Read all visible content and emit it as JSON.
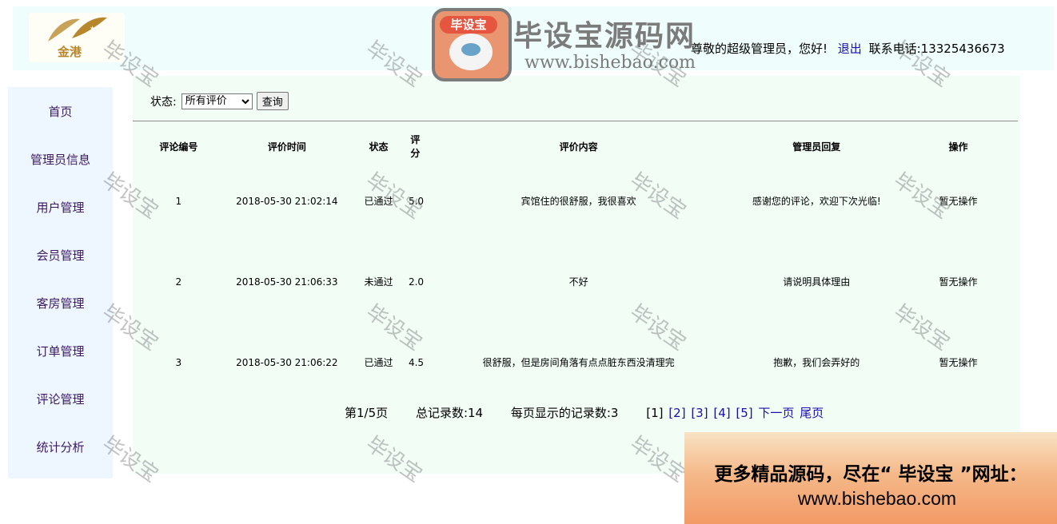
{
  "header": {
    "logo_text": "金港",
    "greeting": "尊敬的超级管理员，您好!",
    "logout_label": "退出",
    "contact": "联系电话:13325436673"
  },
  "sidebar": {
    "items": [
      {
        "label": "首页"
      },
      {
        "label": "管理员信息"
      },
      {
        "label": "用户管理"
      },
      {
        "label": "会员管理"
      },
      {
        "label": "客房管理"
      },
      {
        "label": "订单管理"
      },
      {
        "label": "评论管理"
      },
      {
        "label": "统计分析"
      }
    ]
  },
  "filter": {
    "label": "状态:",
    "selected": "所有评价",
    "query_label": "查询"
  },
  "table": {
    "headers": [
      "评论编号",
      "评价时间",
      "状态",
      "评分",
      "评价内容",
      "管理员回复",
      "操作"
    ],
    "rows": [
      {
        "id": "1",
        "time": "2018-05-30 21:02:14",
        "status": "已通过",
        "score": "5.0",
        "content": "宾馆住的很舒服，我很喜欢",
        "reply": "感谢您的评论，欢迎下次光临!",
        "action": "暂无操作"
      },
      {
        "id": "2",
        "time": "2018-05-30 21:06:33",
        "status": "未通过",
        "score": "2.0",
        "content": "不好",
        "reply": "请说明具体理由",
        "action": "暂无操作"
      },
      {
        "id": "3",
        "time": "2018-05-30 21:06:22",
        "status": "已通过",
        "score": "4.5",
        "content": "很舒服，但是房间角落有点点脏东西没清理完",
        "reply": "抱歉，我们会弄好的",
        "action": "暂无操作"
      }
    ]
  },
  "pager": {
    "page_info": "第1/5页",
    "total": "总记录数:14",
    "per_page": "每页显示的记录数:3",
    "current": "[1]",
    "pages": [
      "[2]",
      "[3]",
      "[4]",
      "[5]"
    ],
    "next": "下一页",
    "last": "尾页"
  },
  "watermark": {
    "text": "毕设宝",
    "brand_badge": "毕设宝",
    "brand_title": "毕设宝源码网",
    "brand_url": "www.bishebao.com"
  },
  "promo": {
    "line1": "更多精品源码，尽在“ 毕设宝 ”网址：",
    "line2": "www.bishebao.com"
  }
}
